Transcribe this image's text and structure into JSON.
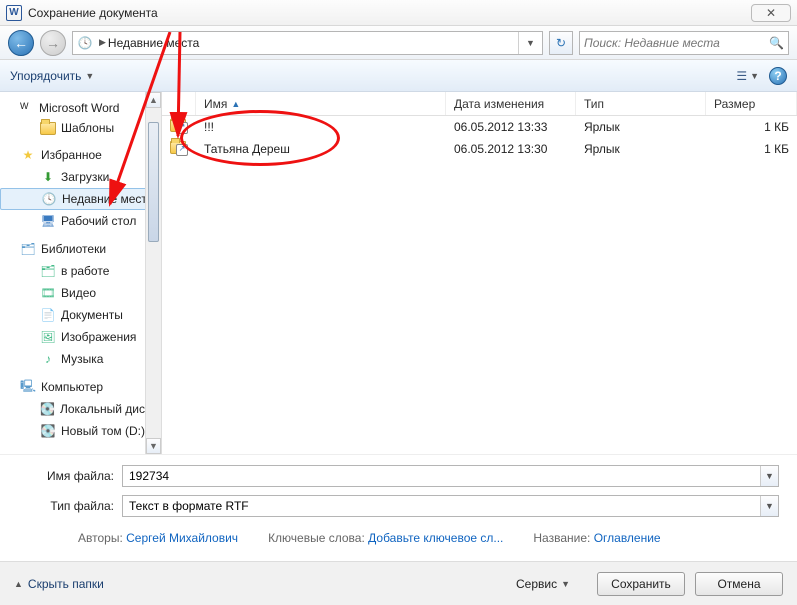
{
  "title": "Сохранение документа",
  "nav": {
    "breadcrumb_root_icon": "⌚",
    "breadcrumb_label": "Недавние места",
    "refresh_icon": "↻",
    "search_placeholder": "Поиск: Недавние места"
  },
  "toolbar": {
    "organize": "Упорядочить",
    "views_icon": "☰",
    "help_icon": "?"
  },
  "tree": {
    "ms_word": "Microsoft Word",
    "templates": "Шаблоны",
    "favorites": "Избранное",
    "downloads": "Загрузки",
    "recent": "Недавние места",
    "desktop": "Рабочий стол",
    "libraries": "Библиотеки",
    "in_work": "в работе",
    "video": "Видео",
    "documents": "Документы",
    "images": "Изображения",
    "music": "Музыка",
    "computer": "Компьютер",
    "disk_c": "Локальный диск (",
    "disk_d": "Новый том (D:)"
  },
  "columns": {
    "name": "Имя",
    "date": "Дата изменения",
    "type": "Тип",
    "size": "Размер"
  },
  "rows": [
    {
      "name": "!!!",
      "date": "06.05.2012 13:33",
      "type": "Ярлык",
      "size": "1 КБ"
    },
    {
      "name": "Татьяна Дереш",
      "date": "06.05.2012 13:30",
      "type": "Ярлык",
      "size": "1 КБ"
    }
  ],
  "form": {
    "filename_label": "Имя файла:",
    "filename_value": "192734",
    "filetype_label": "Тип файла:",
    "filetype_value": "Текст в формате RTF",
    "authors_label": "Авторы:",
    "authors_value": "Сергей Михайлович",
    "keywords_label": "Ключевые слова:",
    "keywords_value": "Добавьте ключевое сл...",
    "title_label": "Название:",
    "title_value": "Оглавление"
  },
  "actions": {
    "hide_folders": "Скрыть папки",
    "service": "Сервис",
    "save": "Сохранить",
    "cancel": "Отмена"
  }
}
